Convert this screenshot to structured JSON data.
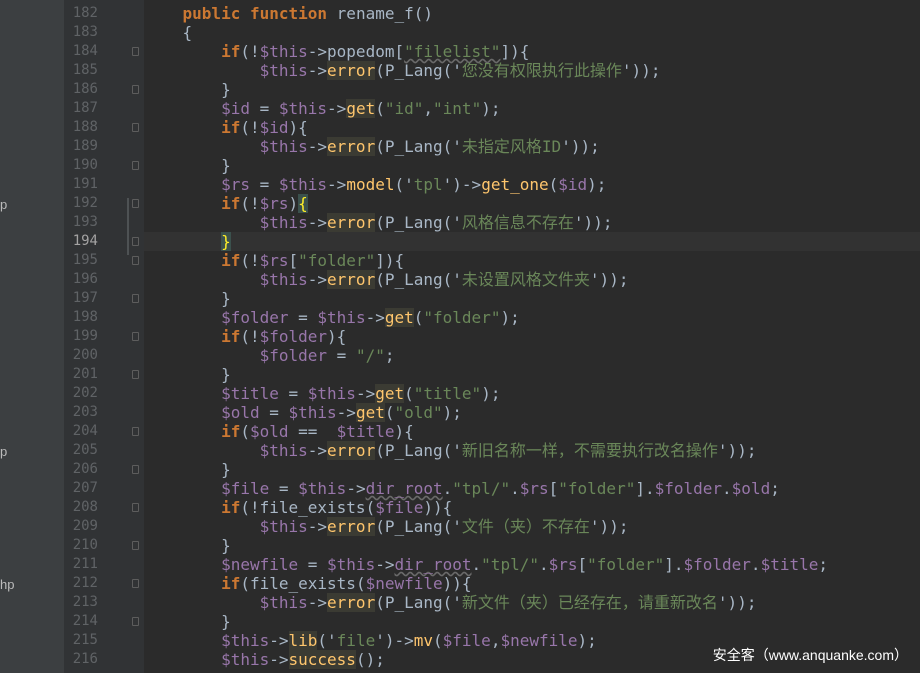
{
  "project_panel": {
    "fragments": [
      {
        "text": "p"
      },
      {
        "text": "p"
      },
      {
        "text": "hp"
      }
    ]
  },
  "gutter": {
    "current_line": "194",
    "line_numbers": [
      "182",
      "183",
      "184",
      "185",
      "186",
      "187",
      "188",
      "189",
      "190",
      "191",
      "192",
      "193",
      "194",
      "195",
      "196",
      "197",
      "198",
      "199",
      "200",
      "201",
      "202",
      "203",
      "204",
      "205",
      "206",
      "207",
      "208",
      "209",
      "210",
      "211",
      "212",
      "213",
      "214",
      "215",
      "216"
    ]
  },
  "code_lines": [
    {
      "indent": "    ",
      "tokens": [
        {
          "t": "public ",
          "c": "kw"
        },
        {
          "t": "function ",
          "c": "kw"
        },
        {
          "t": "rename_f",
          "c": "plain"
        },
        {
          "t": "()",
          "c": "plain"
        }
      ]
    },
    {
      "indent": "    ",
      "tokens": [
        {
          "t": "{",
          "c": "plain"
        }
      ]
    },
    {
      "indent": "        ",
      "tokens": [
        {
          "t": "if",
          "c": "kw"
        },
        {
          "t": "(!",
          "c": "plain"
        },
        {
          "t": "$this",
          "c": "var"
        },
        {
          "t": "->",
          "c": "plain"
        },
        {
          "t": "popedom",
          "c": "plain"
        },
        {
          "t": "[",
          "c": "plain"
        },
        {
          "t": "\"filelist\"",
          "c": "str_und"
        },
        {
          "t": "]){",
          "c": "plain"
        }
      ]
    },
    {
      "indent": "            ",
      "tokens": [
        {
          "t": "$this",
          "c": "var"
        },
        {
          "t": "->",
          "c": "plain"
        },
        {
          "t": "error",
          "c": "fn_hl"
        },
        {
          "t": "(",
          "c": "plain"
        },
        {
          "t": "P_Lang",
          "c": "plain"
        },
        {
          "t": "('",
          "c": "plain"
        },
        {
          "t": "您没有权限执行此操作",
          "c": "str"
        },
        {
          "t": "'));",
          "c": "plain"
        }
      ]
    },
    {
      "indent": "        ",
      "tokens": [
        {
          "t": "}",
          "c": "plain"
        }
      ]
    },
    {
      "indent": "        ",
      "tokens": [
        {
          "t": "$id",
          "c": "var"
        },
        {
          "t": " = ",
          "c": "plain"
        },
        {
          "t": "$this",
          "c": "var"
        },
        {
          "t": "->",
          "c": "plain"
        },
        {
          "t": "get",
          "c": "fn_hl"
        },
        {
          "t": "(",
          "c": "plain"
        },
        {
          "t": "\"id\"",
          "c": "str"
        },
        {
          "t": ",",
          "c": "plain"
        },
        {
          "t": "\"int\"",
          "c": "str"
        },
        {
          "t": ");",
          "c": "plain"
        }
      ]
    },
    {
      "indent": "        ",
      "tokens": [
        {
          "t": "if",
          "c": "kw"
        },
        {
          "t": "(!",
          "c": "plain"
        },
        {
          "t": "$id",
          "c": "var"
        },
        {
          "t": "){",
          "c": "plain"
        }
      ]
    },
    {
      "indent": "            ",
      "tokens": [
        {
          "t": "$this",
          "c": "var"
        },
        {
          "t": "->",
          "c": "plain"
        },
        {
          "t": "error",
          "c": "fn_hl"
        },
        {
          "t": "(",
          "c": "plain"
        },
        {
          "t": "P_Lang",
          "c": "plain"
        },
        {
          "t": "('",
          "c": "plain"
        },
        {
          "t": "未指定风格ID",
          "c": "str"
        },
        {
          "t": "'));",
          "c": "plain"
        }
      ]
    },
    {
      "indent": "        ",
      "tokens": [
        {
          "t": "}",
          "c": "plain"
        }
      ]
    },
    {
      "indent": "        ",
      "tokens": [
        {
          "t": "$rs",
          "c": "var"
        },
        {
          "t": " = ",
          "c": "plain"
        },
        {
          "t": "$this",
          "c": "var"
        },
        {
          "t": "->",
          "c": "plain"
        },
        {
          "t": "model",
          "c": "fn"
        },
        {
          "t": "('",
          "c": "plain"
        },
        {
          "t": "tpl",
          "c": "str"
        },
        {
          "t": "')->",
          "c": "plain"
        },
        {
          "t": "get_one",
          "c": "fn"
        },
        {
          "t": "(",
          "c": "plain"
        },
        {
          "t": "$id",
          "c": "var"
        },
        {
          "t": ");",
          "c": "plain"
        }
      ]
    },
    {
      "indent": "        ",
      "tokens": [
        {
          "t": "if",
          "c": "kw"
        },
        {
          "t": "(!",
          "c": "plain"
        },
        {
          "t": "$rs",
          "c": "var"
        },
        {
          "t": ")",
          "c": "plain"
        },
        {
          "t": "{",
          "c": "brace"
        }
      ]
    },
    {
      "indent": "            ",
      "tokens": [
        {
          "t": "$this",
          "c": "var"
        },
        {
          "t": "->",
          "c": "plain"
        },
        {
          "t": "error",
          "c": "fn_hl"
        },
        {
          "t": "(",
          "c": "plain"
        },
        {
          "t": "P_Lang",
          "c": "plain"
        },
        {
          "t": "('",
          "c": "plain"
        },
        {
          "t": "风格信息不存在",
          "c": "str"
        },
        {
          "t": "'));",
          "c": "plain"
        }
      ]
    },
    {
      "indent": "        ",
      "tokens": [
        {
          "t": "}",
          "c": "brace"
        }
      ]
    },
    {
      "indent": "        ",
      "tokens": [
        {
          "t": "if",
          "c": "kw"
        },
        {
          "t": "(!",
          "c": "plain"
        },
        {
          "t": "$rs",
          "c": "var"
        },
        {
          "t": "[",
          "c": "plain"
        },
        {
          "t": "\"folder\"",
          "c": "str"
        },
        {
          "t": "]){",
          "c": "plain"
        }
      ]
    },
    {
      "indent": "            ",
      "tokens": [
        {
          "t": "$this",
          "c": "var"
        },
        {
          "t": "->",
          "c": "plain"
        },
        {
          "t": "error",
          "c": "fn_hl"
        },
        {
          "t": "(",
          "c": "plain"
        },
        {
          "t": "P_Lang",
          "c": "plain"
        },
        {
          "t": "('",
          "c": "plain"
        },
        {
          "t": "未设置风格文件夹",
          "c": "str"
        },
        {
          "t": "'));",
          "c": "plain"
        }
      ]
    },
    {
      "indent": "        ",
      "tokens": [
        {
          "t": "}",
          "c": "plain"
        }
      ]
    },
    {
      "indent": "        ",
      "tokens": [
        {
          "t": "$folder",
          "c": "var"
        },
        {
          "t": " = ",
          "c": "plain"
        },
        {
          "t": "$this",
          "c": "var"
        },
        {
          "t": "->",
          "c": "plain"
        },
        {
          "t": "get",
          "c": "fn_hl"
        },
        {
          "t": "(",
          "c": "plain"
        },
        {
          "t": "\"folder\"",
          "c": "str"
        },
        {
          "t": ");",
          "c": "plain"
        }
      ]
    },
    {
      "indent": "        ",
      "tokens": [
        {
          "t": "if",
          "c": "kw"
        },
        {
          "t": "(!",
          "c": "plain"
        },
        {
          "t": "$folder",
          "c": "var"
        },
        {
          "t": "){",
          "c": "plain"
        }
      ]
    },
    {
      "indent": "            ",
      "tokens": [
        {
          "t": "$folder",
          "c": "var"
        },
        {
          "t": " = ",
          "c": "plain"
        },
        {
          "t": "\"/\"",
          "c": "str"
        },
        {
          "t": ";",
          "c": "plain"
        }
      ]
    },
    {
      "indent": "        ",
      "tokens": [
        {
          "t": "}",
          "c": "plain"
        }
      ]
    },
    {
      "indent": "        ",
      "tokens": [
        {
          "t": "$title",
          "c": "var"
        },
        {
          "t": " = ",
          "c": "plain"
        },
        {
          "t": "$this",
          "c": "var"
        },
        {
          "t": "->",
          "c": "plain"
        },
        {
          "t": "get",
          "c": "fn_hl"
        },
        {
          "t": "(",
          "c": "plain"
        },
        {
          "t": "\"title\"",
          "c": "str"
        },
        {
          "t": ");",
          "c": "plain"
        }
      ]
    },
    {
      "indent": "        ",
      "tokens": [
        {
          "t": "$old",
          "c": "var"
        },
        {
          "t": " = ",
          "c": "plain"
        },
        {
          "t": "$this",
          "c": "var"
        },
        {
          "t": "->",
          "c": "plain"
        },
        {
          "t": "get",
          "c": "fn_hl"
        },
        {
          "t": "(",
          "c": "plain"
        },
        {
          "t": "\"old\"",
          "c": "str"
        },
        {
          "t": ");",
          "c": "plain"
        }
      ]
    },
    {
      "indent": "        ",
      "tokens": [
        {
          "t": "if",
          "c": "kw"
        },
        {
          "t": "(",
          "c": "plain"
        },
        {
          "t": "$old",
          "c": "var"
        },
        {
          "t": " ==  ",
          "c": "plain"
        },
        {
          "t": "$title",
          "c": "var"
        },
        {
          "t": "){",
          "c": "plain"
        }
      ]
    },
    {
      "indent": "            ",
      "tokens": [
        {
          "t": "$this",
          "c": "var"
        },
        {
          "t": "->",
          "c": "plain"
        },
        {
          "t": "error",
          "c": "fn_hl"
        },
        {
          "t": "(",
          "c": "plain"
        },
        {
          "t": "P_Lang",
          "c": "plain"
        },
        {
          "t": "('",
          "c": "plain"
        },
        {
          "t": "新旧名称一样，不需要执行改名操作",
          "c": "str"
        },
        {
          "t": "'));",
          "c": "plain"
        }
      ]
    },
    {
      "indent": "        ",
      "tokens": [
        {
          "t": "}",
          "c": "plain"
        }
      ]
    },
    {
      "indent": "        ",
      "tokens": [
        {
          "t": "$file",
          "c": "var"
        },
        {
          "t": " = ",
          "c": "plain"
        },
        {
          "t": "$this",
          "c": "var"
        },
        {
          "t": "->",
          "c": "plain"
        },
        {
          "t": "dir_root",
          "c": "var_und"
        },
        {
          "t": ".",
          "c": "plain"
        },
        {
          "t": "\"tpl/\"",
          "c": "str"
        },
        {
          "t": ".",
          "c": "plain"
        },
        {
          "t": "$rs",
          "c": "var"
        },
        {
          "t": "[",
          "c": "plain"
        },
        {
          "t": "\"folder\"",
          "c": "str"
        },
        {
          "t": "].",
          "c": "plain"
        },
        {
          "t": "$folder",
          "c": "var"
        },
        {
          "t": ".",
          "c": "plain"
        },
        {
          "t": "$old",
          "c": "var"
        },
        {
          "t": ";",
          "c": "plain"
        }
      ]
    },
    {
      "indent": "        ",
      "tokens": [
        {
          "t": "if",
          "c": "kw"
        },
        {
          "t": "(!",
          "c": "plain"
        },
        {
          "t": "file_exists",
          "c": "plain"
        },
        {
          "t": "(",
          "c": "plain"
        },
        {
          "t": "$file",
          "c": "var"
        },
        {
          "t": ")){",
          "c": "plain"
        }
      ]
    },
    {
      "indent": "            ",
      "tokens": [
        {
          "t": "$this",
          "c": "var"
        },
        {
          "t": "->",
          "c": "plain"
        },
        {
          "t": "error",
          "c": "fn_hl"
        },
        {
          "t": "(",
          "c": "plain"
        },
        {
          "t": "P_Lang",
          "c": "plain"
        },
        {
          "t": "('",
          "c": "plain"
        },
        {
          "t": "文件（夹）不存在",
          "c": "str"
        },
        {
          "t": "'));",
          "c": "plain"
        }
      ]
    },
    {
      "indent": "        ",
      "tokens": [
        {
          "t": "}",
          "c": "plain"
        }
      ]
    },
    {
      "indent": "        ",
      "tokens": [
        {
          "t": "$newfile",
          "c": "var"
        },
        {
          "t": " = ",
          "c": "plain"
        },
        {
          "t": "$this",
          "c": "var"
        },
        {
          "t": "->",
          "c": "plain"
        },
        {
          "t": "dir_root",
          "c": "var_und"
        },
        {
          "t": ".",
          "c": "plain"
        },
        {
          "t": "\"tpl/\"",
          "c": "str"
        },
        {
          "t": ".",
          "c": "plain"
        },
        {
          "t": "$rs",
          "c": "var"
        },
        {
          "t": "[",
          "c": "plain"
        },
        {
          "t": "\"folder\"",
          "c": "str"
        },
        {
          "t": "].",
          "c": "plain"
        },
        {
          "t": "$folder",
          "c": "var"
        },
        {
          "t": ".",
          "c": "plain"
        },
        {
          "t": "$title",
          "c": "var"
        },
        {
          "t": ";",
          "c": "plain"
        }
      ]
    },
    {
      "indent": "        ",
      "tokens": [
        {
          "t": "if",
          "c": "kw"
        },
        {
          "t": "(",
          "c": "plain"
        },
        {
          "t": "file_exists",
          "c": "plain"
        },
        {
          "t": "(",
          "c": "plain"
        },
        {
          "t": "$newfile",
          "c": "var"
        },
        {
          "t": ")){",
          "c": "plain"
        }
      ]
    },
    {
      "indent": "            ",
      "tokens": [
        {
          "t": "$this",
          "c": "var"
        },
        {
          "t": "->",
          "c": "plain"
        },
        {
          "t": "error",
          "c": "fn_hl"
        },
        {
          "t": "(",
          "c": "plain"
        },
        {
          "t": "P_Lang",
          "c": "plain"
        },
        {
          "t": "('",
          "c": "plain"
        },
        {
          "t": "新文件（夹）已经存在，请重新改名",
          "c": "str"
        },
        {
          "t": "'));",
          "c": "plain"
        }
      ]
    },
    {
      "indent": "        ",
      "tokens": [
        {
          "t": "}",
          "c": "plain"
        }
      ]
    },
    {
      "indent": "        ",
      "tokens": [
        {
          "t": "$this",
          "c": "var"
        },
        {
          "t": "->",
          "c": "plain"
        },
        {
          "t": "lib",
          "c": "fn_hl"
        },
        {
          "t": "('",
          "c": "plain"
        },
        {
          "t": "file",
          "c": "str"
        },
        {
          "t": "')->",
          "c": "plain"
        },
        {
          "t": "mv",
          "c": "fn"
        },
        {
          "t": "(",
          "c": "plain"
        },
        {
          "t": "$file",
          "c": "var"
        },
        {
          "t": ",",
          "c": "plain"
        },
        {
          "t": "$newfile",
          "c": "var"
        },
        {
          "t": ");",
          "c": "plain"
        }
      ]
    },
    {
      "indent": "        ",
      "tokens": [
        {
          "t": "$this",
          "c": "var"
        },
        {
          "t": "->",
          "c": "plain"
        },
        {
          "t": "success",
          "c": "fn_hl"
        },
        {
          "t": "();",
          "c": "plain"
        }
      ]
    }
  ],
  "watermark": "安全客（www.anquanke.com）",
  "colors": {
    "editor_bg": "#2b2b2b",
    "gutter_bg": "#313335",
    "keyword": "#cc7832",
    "variable": "#9876aa",
    "string": "#6a8759",
    "function": "#ffc66d",
    "plain": "#a9b7c6",
    "brace_match": "#ffef28"
  }
}
